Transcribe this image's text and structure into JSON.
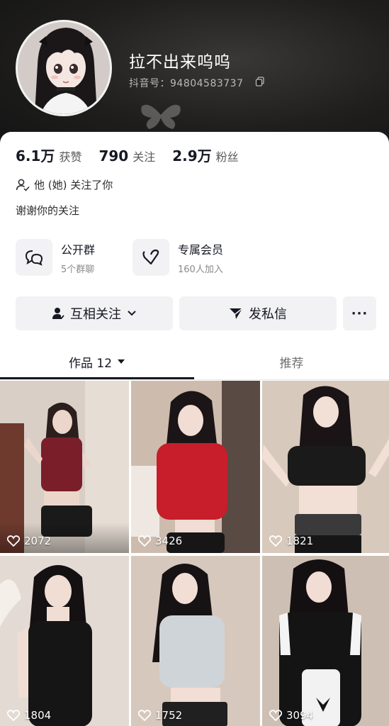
{
  "profile": {
    "nickname": "拉不出来呜呜",
    "douyin_id": "抖音号：94804583737"
  },
  "stats": [
    {
      "value": "6.1万",
      "label": "获赞"
    },
    {
      "value": "790",
      "label": "关注"
    },
    {
      "value": "2.9万",
      "label": "粉丝"
    }
  ],
  "mutual_text": "他 (她) 关注了你",
  "bio": "谢谢你的关注",
  "features": [
    {
      "title": "公开群",
      "subtitle": "5个群聊",
      "icon": "chat-bubbles-icon"
    },
    {
      "title": "专属会员",
      "subtitle": "160人加入",
      "icon": "heart-v-icon"
    }
  ],
  "actions": {
    "follow_label": "互相关注",
    "message_label": "发私信",
    "more_label": "···"
  },
  "tabs": {
    "works_label": "作品 12",
    "recommend_label": "推荐"
  },
  "videos": [
    {
      "likes": "2072",
      "top_color": "#7a1e2a",
      "bottom_color": "#1a1a1a"
    },
    {
      "likes": "3426",
      "top_color": "#c81d2a",
      "bottom_color": "#161616"
    },
    {
      "likes": "1821",
      "top_color": "#1a1a1a",
      "bottom_color": "#3a3a3a"
    },
    {
      "likes": "1804",
      "top_color": "#151515",
      "bottom_color": "#151515"
    },
    {
      "likes": "1752",
      "top_color": "#cfd4d8",
      "bottom_color": "#202020"
    },
    {
      "likes": "3094",
      "top_color": "#141414",
      "bottom_color": "#f2f2f2"
    }
  ],
  "colors": {
    "header_bg": "#1f1e1d",
    "text_primary": "#161823",
    "button_bg": "#f2f2f4"
  }
}
